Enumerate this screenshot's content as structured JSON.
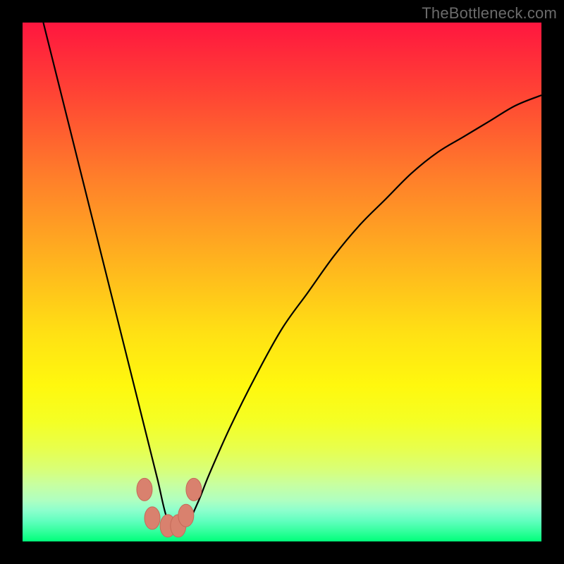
{
  "watermark": "TheBottleneck.com",
  "chart_data": {
    "type": "line",
    "title": "",
    "xlabel": "",
    "ylabel": "",
    "xlim": [
      0,
      100
    ],
    "ylim": [
      0,
      100
    ],
    "grid": false,
    "curve_minimum_x": 28,
    "series": [
      {
        "name": "bottleneck-curve",
        "x": [
          4,
          6,
          8,
          10,
          12,
          14,
          16,
          18,
          20,
          22,
          24,
          26,
          28,
          30,
          32,
          34,
          36,
          40,
          45,
          50,
          55,
          60,
          65,
          70,
          75,
          80,
          85,
          90,
          95,
          100
        ],
        "values": [
          100,
          92,
          84,
          76,
          68,
          60,
          52,
          44,
          36,
          28,
          20,
          12,
          4,
          3,
          4,
          8,
          13,
          22,
          32,
          41,
          48,
          55,
          61,
          66,
          71,
          75,
          78,
          81,
          84,
          86
        ]
      }
    ],
    "markers": [
      {
        "x": 23.5,
        "y": 10,
        "name": "left-upper"
      },
      {
        "x": 25,
        "y": 4.5,
        "name": "left-lower"
      },
      {
        "x": 28,
        "y": 3,
        "name": "bottom-left"
      },
      {
        "x": 30,
        "y": 3,
        "name": "bottom-right"
      },
      {
        "x": 31.5,
        "y": 5,
        "name": "right-lower"
      },
      {
        "x": 33,
        "y": 10,
        "name": "right-upper"
      }
    ],
    "gradient_stops": [
      {
        "pos": 0,
        "color": "#ff163f"
      },
      {
        "pos": 14,
        "color": "#ff4534"
      },
      {
        "pos": 30,
        "color": "#ff7f2a"
      },
      {
        "pos": 45,
        "color": "#ffb01f"
      },
      {
        "pos": 60,
        "color": "#ffe114"
      },
      {
        "pos": 70,
        "color": "#fff80e"
      },
      {
        "pos": 77,
        "color": "#f4ff25"
      },
      {
        "pos": 82,
        "color": "#e8ff4c"
      },
      {
        "pos": 86,
        "color": "#d9ff76"
      },
      {
        "pos": 89,
        "color": "#c8ffa0"
      },
      {
        "pos": 92,
        "color": "#b0ffc0"
      },
      {
        "pos": 94,
        "color": "#8dffcd"
      },
      {
        "pos": 96,
        "color": "#62ffbf"
      },
      {
        "pos": 98,
        "color": "#34ff9e"
      },
      {
        "pos": 100,
        "color": "#00ff7a"
      }
    ],
    "colors": {
      "curve": "#000000",
      "marker_fill": "#d9816e",
      "marker_stroke": "#c46a58",
      "frame": "#000000"
    }
  }
}
